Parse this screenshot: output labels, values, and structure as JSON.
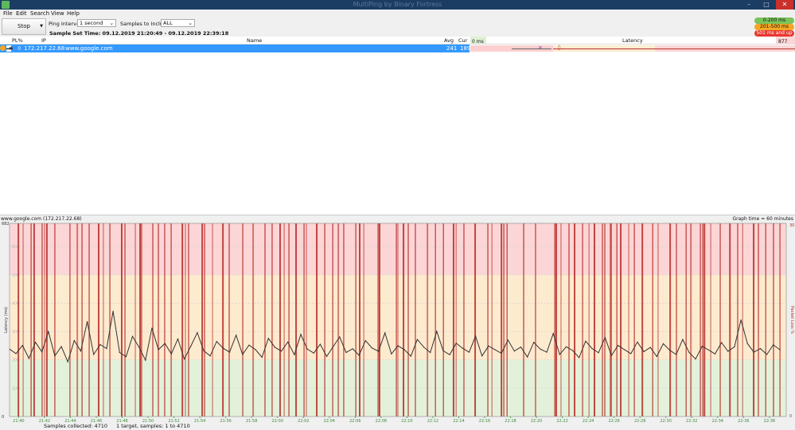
{
  "window": {
    "title": "MultiPing by Binary Fortress",
    "minimize": "–",
    "maximize": "□",
    "close": "✕"
  },
  "menu": [
    "File",
    "Edit",
    "Search",
    "View",
    "Help"
  ],
  "toolbar": {
    "stop_label": "Stop",
    "ping_interval_label": "Ping Interval:",
    "ping_interval_value": "1 second",
    "samples_label": "Samples to Include:",
    "samples_value": "ALL",
    "sample_set_time": "Sample Set Time: 09.12.2019 21:20:49 - 09.12.2019 22:39:18"
  },
  "legend": [
    {
      "label": "0-200 ms",
      "color": "#7cc35a"
    },
    {
      "label": "201-500 ms",
      "color": "#f5a623"
    },
    {
      "label": "501 ms and up",
      "color": "#e8382f"
    }
  ],
  "columns": {
    "pl": "PL%",
    "ip": "IP",
    "name": "Name",
    "avg": "Avg",
    "cur": "Cur",
    "latency": "Latency",
    "lat_min": "0 ms",
    "lat_max": "877 ms"
  },
  "rows": [
    {
      "pl": "8",
      "ip": "172.217.22.68",
      "name": "www.google.com",
      "avg": "241",
      "cur": "189"
    }
  ],
  "graph": {
    "title": "www.google.com (172.217.22.68)",
    "graph_time": "Graph time = 60 minutes"
  },
  "status": {
    "samples_collected": "Samples collected: 4710",
    "targets": "1 target, samples: 1 to 4710"
  },
  "chart_data": {
    "type": "line",
    "ylabel": "Latency (ms)",
    "y2label": "Packet Loss %",
    "ylim": [
      0,
      682
    ],
    "y2lim": [
      0,
      30
    ],
    "y_ticks": [
      "682",
      "600",
      "500",
      "400",
      "300",
      "200",
      "100",
      "0"
    ],
    "y2_ticks": [
      "30",
      "0"
    ],
    "x_ticks": [
      "21:40",
      "21:42",
      "21:44",
      "21:46",
      "21:48",
      "21:50",
      "21:52",
      "21:54",
      "21:56",
      "21:58",
      "22:00",
      "22:02",
      "22:04",
      "22:06",
      "22:08",
      "22:10",
      "22:12",
      "22:14",
      "22:16",
      "22:18",
      "22:20",
      "22:22",
      "22:24",
      "22:26",
      "22:28",
      "22:30",
      "22:32",
      "22:34",
      "22:36",
      "22:38"
    ],
    "xlim": [
      "21:39:18",
      "22:39:18"
    ],
    "zones": [
      {
        "from": 0,
        "to": 200,
        "color": "#e3f1da"
      },
      {
        "from": 200,
        "to": 500,
        "color": "#fdebcf"
      },
      {
        "from": 500,
        "to": 682,
        "color": "#fcd6d6"
      }
    ],
    "latency_series": {
      "start": "21:39:18",
      "interval_s": 30,
      "values": [
        238,
        222,
        251,
        205,
        262,
        228,
        300,
        214,
        247,
        193,
        268,
        231,
        335,
        219,
        254,
        240,
        372,
        226,
        211,
        283,
        245,
        199,
        312,
        236,
        258,
        221,
        274,
        203,
        248,
        296,
        232,
        214,
        265,
        241,
        227,
        287,
        219,
        252,
        236,
        209,
        276,
        244,
        231,
        263,
        218,
        290,
        238,
        224,
        255,
        212,
        247,
        281,
        226,
        239,
        216,
        268,
        242,
        230,
        295,
        221,
        250,
        236,
        213,
        272,
        245,
        226,
        301,
        232,
        218,
        259,
        241,
        227,
        284,
        214,
        249,
        236,
        223,
        270,
        231,
        245,
        210,
        262,
        238,
        227,
        293,
        219,
        246,
        233,
        208,
        266,
        240,
        225,
        279,
        215,
        251,
        236,
        222,
        263,
        229,
        244,
        212,
        257,
        234,
        219,
        272,
        226,
        203,
        248,
        235,
        221,
        261,
        230,
        246,
        341,
        258,
        227,
        240,
        219,
        253,
        236
      ]
    },
    "packet_loss_times": [
      "21:39:59",
      "21:40:21",
      "21:40:58",
      "21:41:12",
      "21:41:49",
      "21:42:00",
      "21:42:11",
      "21:42:48",
      "21:43:58",
      "21:44:32",
      "21:44:54",
      "21:45:27",
      "21:46:11",
      "21:46:33",
      "21:47:03",
      "21:47:58",
      "21:48:13",
      "21:49:01",
      "21:49:23",
      "21:49:30",
      "21:50:22",
      "21:50:48",
      "21:51:17",
      "21:51:47",
      "21:52:39",
      "21:52:53",
      "21:53:08",
      "21:54:11",
      "21:54:22",
      "21:54:59",
      "21:55:47",
      "21:56:16",
      "21:57:19",
      "21:58:07",
      "21:59:02",
      "21:59:35",
      "22:00:12",
      "22:00:31",
      "22:00:53",
      "22:01:26",
      "22:02:03",
      "22:02:14",
      "22:03:02",
      "22:03:39",
      "22:04:16",
      "22:04:42",
      "22:05:07",
      "22:06:03",
      "22:06:21",
      "22:06:40",
      "22:07:46",
      "22:07:53",
      "22:09:11",
      "22:09:18",
      "22:09:44",
      "22:10:06",
      "22:10:39",
      "22:11:35",
      "22:12:12",
      "22:12:49",
      "22:13:36",
      "22:13:48",
      "22:14:24",
      "22:15:16",
      "22:16:15",
      "22:16:34",
      "22:17:18",
      "22:17:29",
      "22:17:44",
      "22:19:01",
      "22:19:56",
      "22:21:25",
      "22:21:32",
      "22:21:54",
      "22:22:31",
      "22:22:57",
      "22:23:34",
      "22:24:04",
      "22:24:29",
      "22:25:06",
      "22:25:17",
      "22:25:43",
      "22:25:47",
      "22:26:13",
      "22:26:31",
      "22:27:08",
      "22:27:34",
      "22:28:11",
      "22:28:59",
      "22:29:24",
      "22:30:20",
      "22:30:49",
      "22:31:34",
      "22:31:56",
      "22:32:40",
      "22:32:51",
      "22:32:59",
      "22:33:28",
      "22:34:12",
      "22:34:57",
      "22:35:33",
      "22:35:56",
      "22:36:47",
      "22:37:09",
      "22:37:43",
      "22:38:19",
      "22:38:49"
    ],
    "loss_color": "#b3201c",
    "line_color": "#333333"
  }
}
